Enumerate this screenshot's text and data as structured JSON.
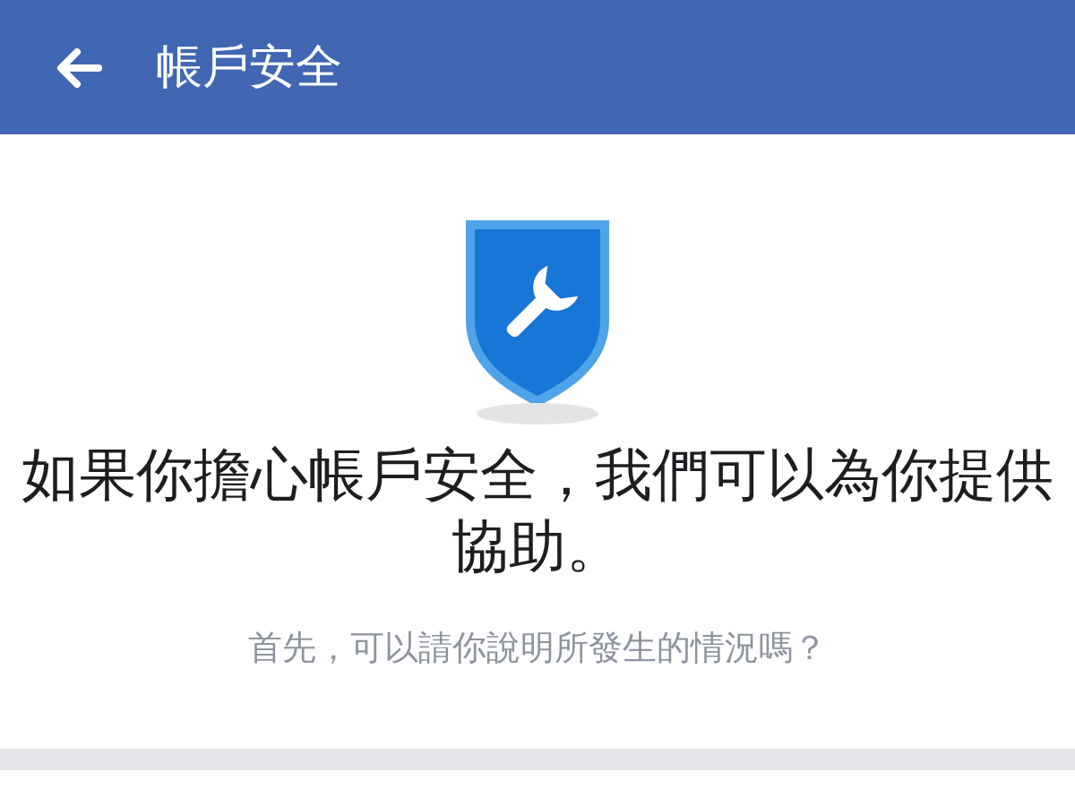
{
  "header": {
    "title": "帳戶安全"
  },
  "heading": "如果你擔心帳戶安全，我們可以為你提供協助。",
  "subtitle": "首先，可以請你說明所發生的情況嗎？"
}
